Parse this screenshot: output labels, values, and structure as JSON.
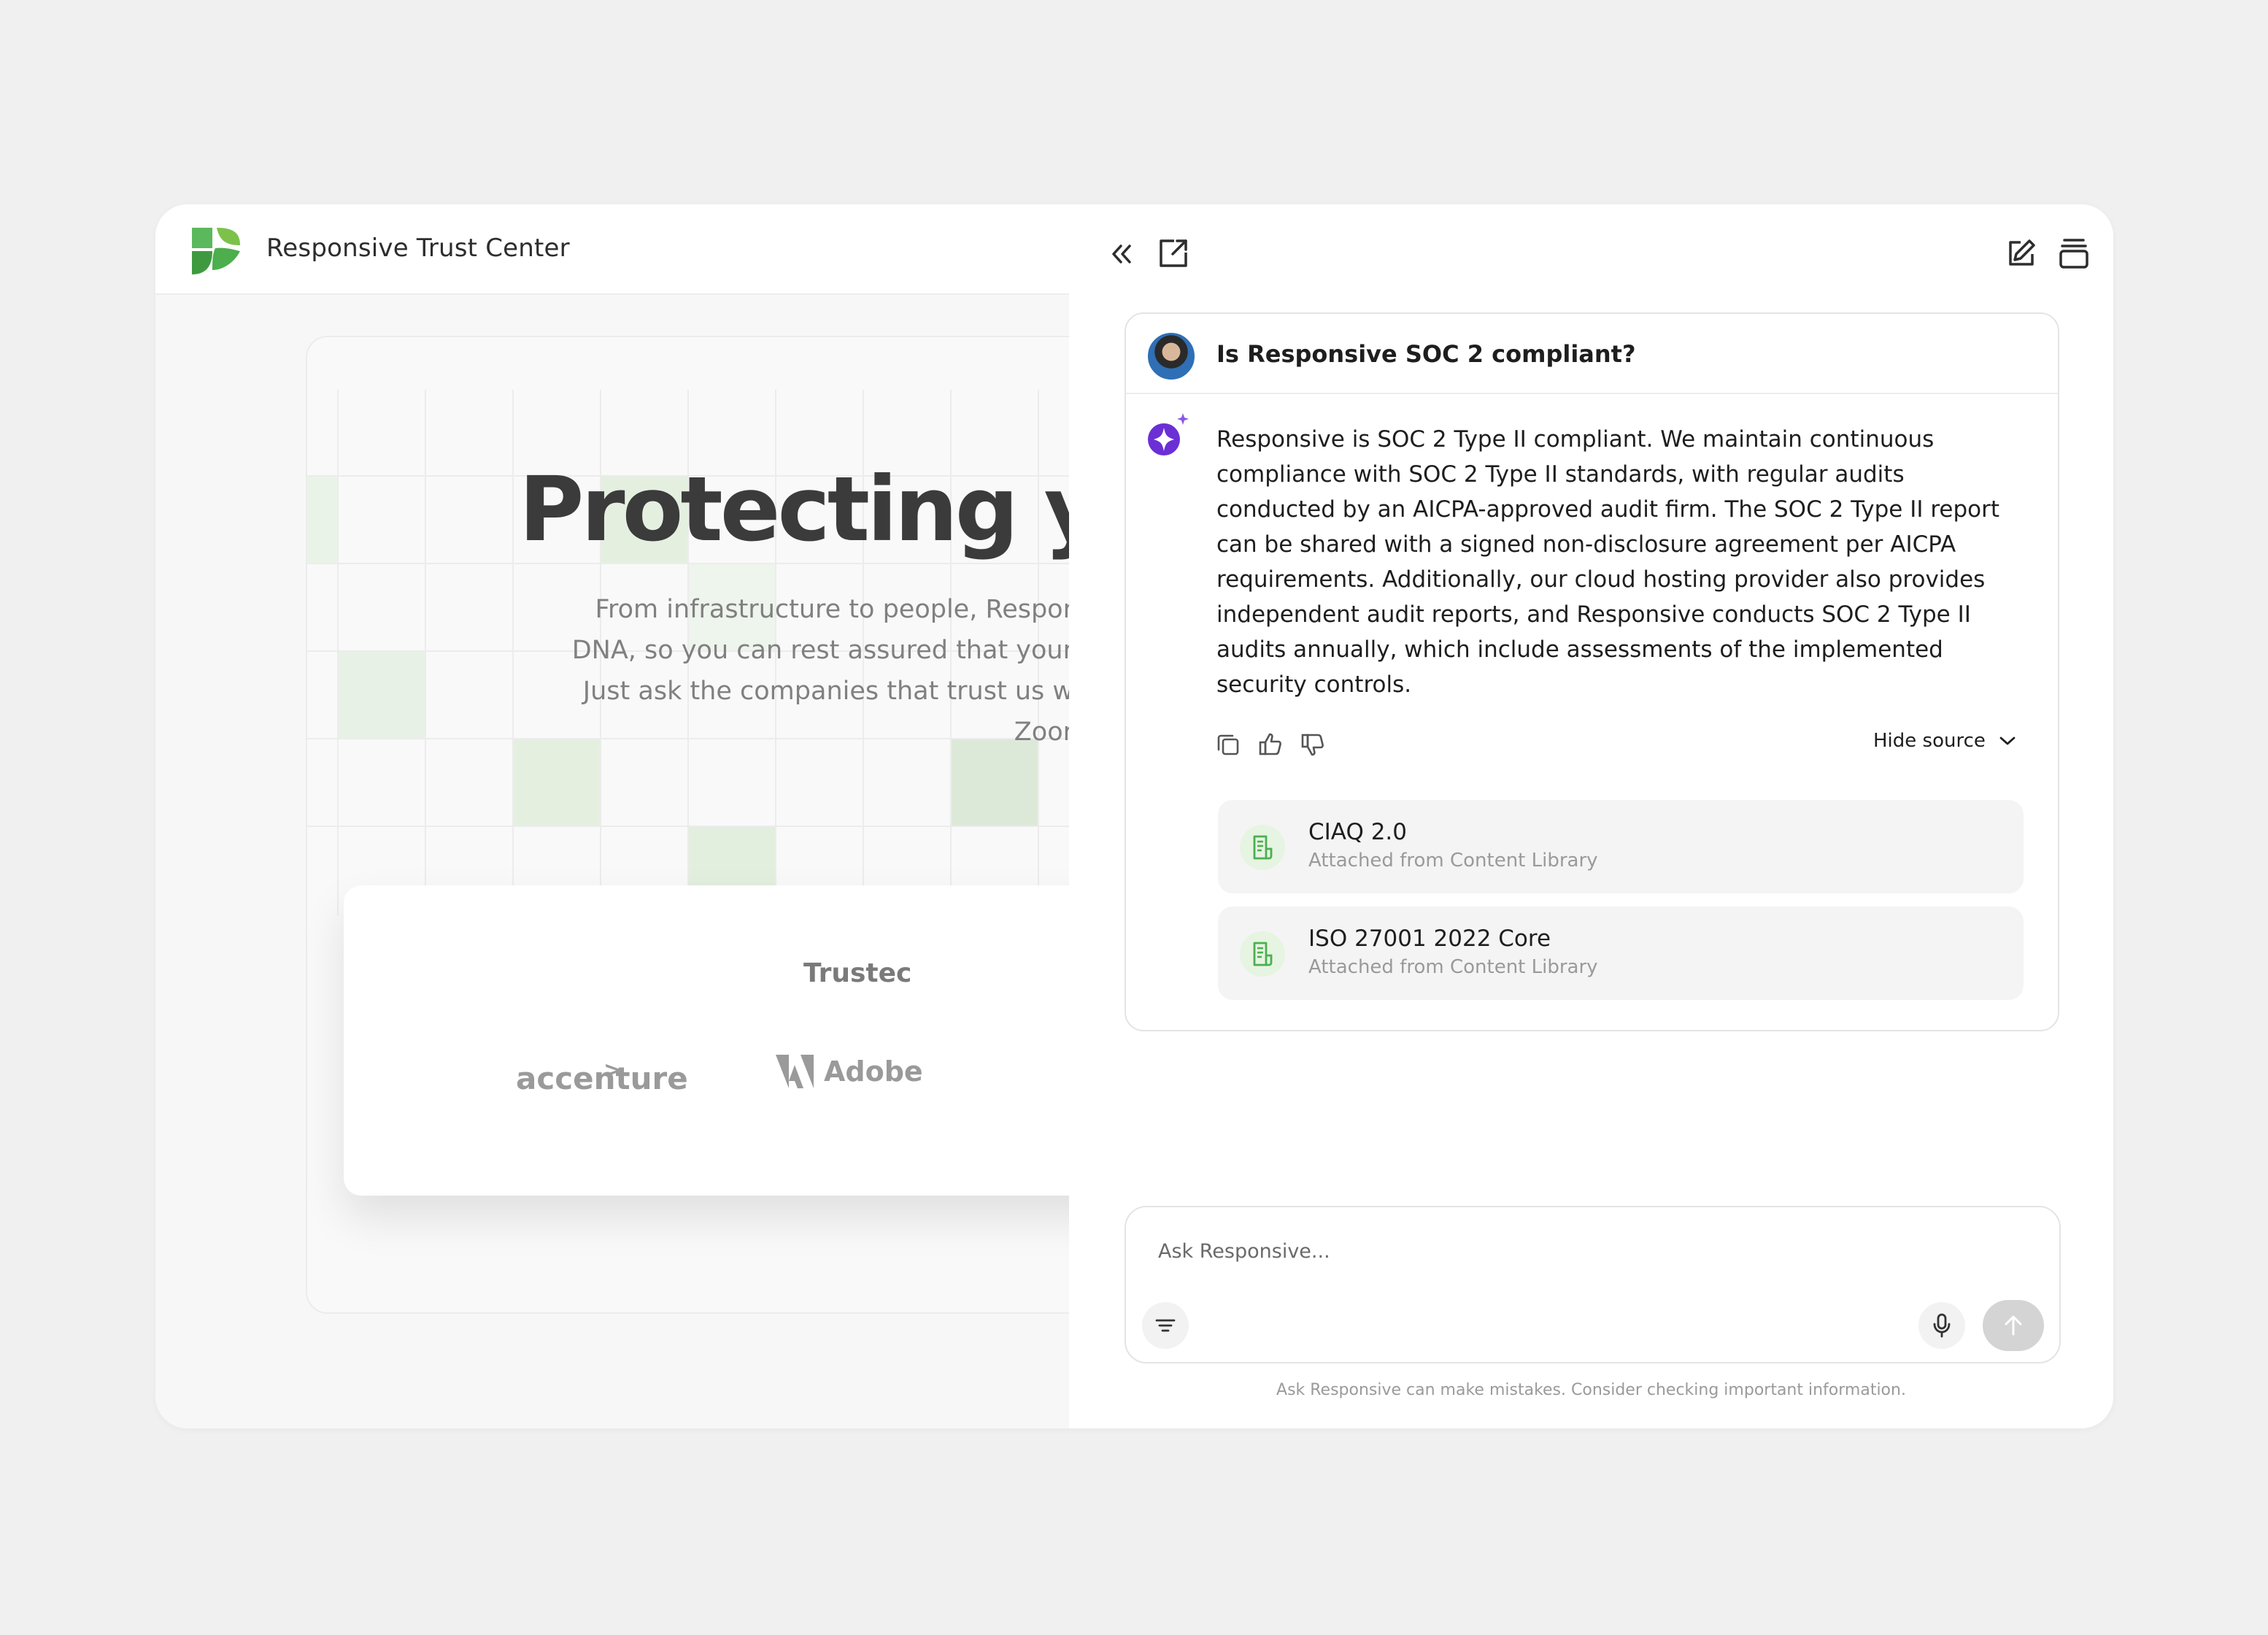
{
  "trust_center": {
    "title": "Responsive Trust Center",
    "hero_title": "Protecting your",
    "hero_sub_lines": [
      "From infrastructure to people, Respor",
      "DNA, so you can rest assured that your",
      "Just ask the companies that trust us w",
      "Zoor"
    ],
    "trusted_label": "Trustec",
    "companies": [
      "accenture",
      "Adobe"
    ],
    "brand_green": "#5cb85c"
  },
  "chat": {
    "toolbar": {
      "collapse_icon": "double-chevron-left-icon",
      "open_external_icon": "external-link-icon",
      "new_chat_icon": "edit-icon",
      "history_icon": "stack-icon"
    },
    "question": "Is Responsive SOC 2 compliant?",
    "answer_lines": [
      "Responsive is SOC 2 Type II compliant. We maintain continuous",
      "compliance with SOC 2 Type II standards, with regular audits",
      "conducted by an AICPA-approved audit firm. The SOC 2 Type II report",
      "can be shared with a signed non-disclosure agreement per AICPA",
      "requirements. Additionally, our cloud hosting provider also provides",
      "independent audit reports, and Responsive conducts SOC 2 Type II",
      "audits annually, which include assessments of the implemented",
      "security controls."
    ],
    "hide_source_label": "Hide source",
    "sources": [
      {
        "title": "CIAQ 2.0",
        "subtitle": "Attached from Content Library"
      },
      {
        "title": "ISO 27001 2022 Core",
        "subtitle": "Attached from Content Library"
      }
    ],
    "input_placeholder": "Ask Responsive...",
    "disclaimer": "Ask Responsive can make mistakes. Consider checking important information.",
    "ai_accent": "#6b2fd6"
  }
}
